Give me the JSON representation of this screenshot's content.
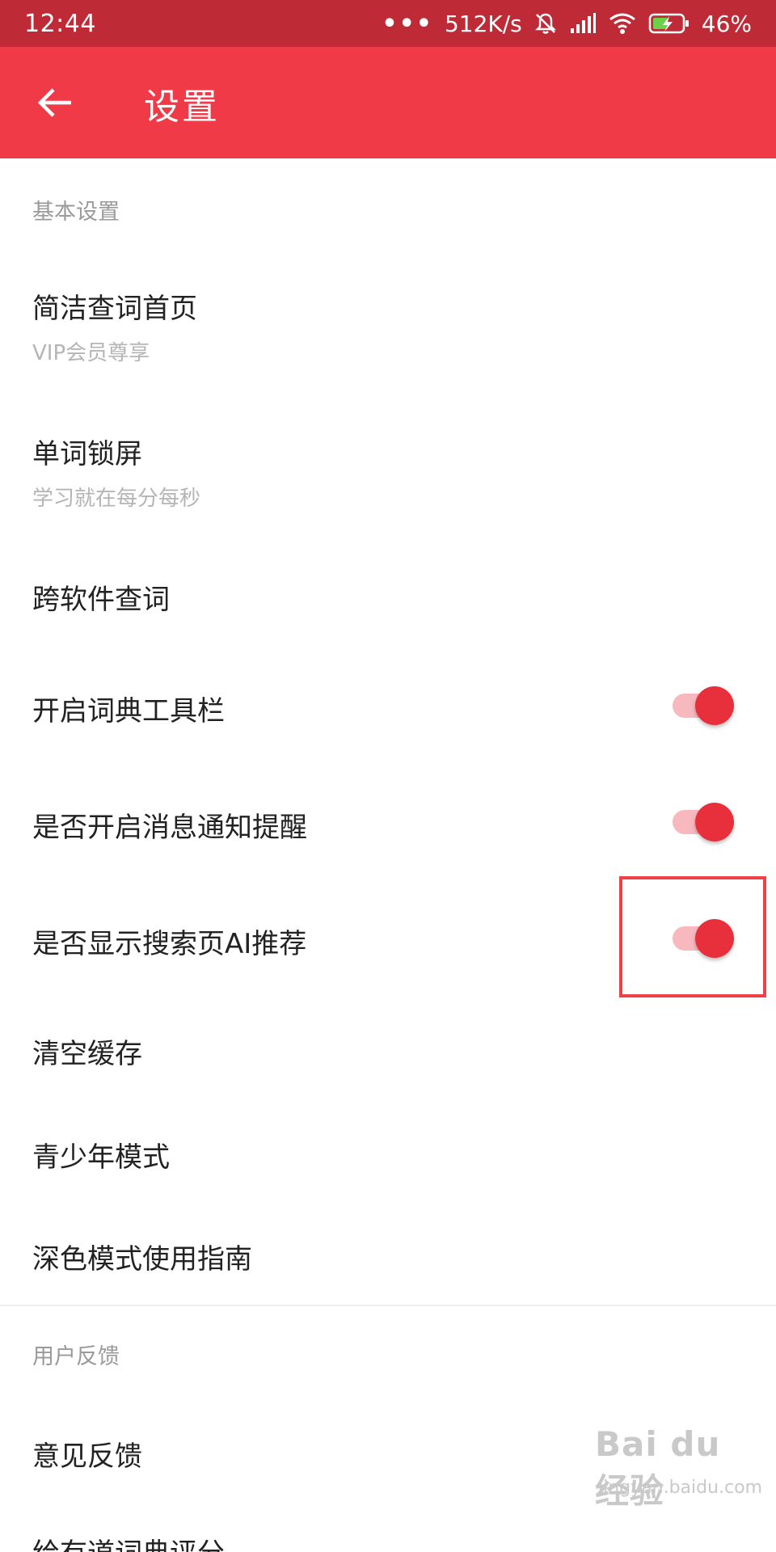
{
  "status_bar": {
    "time": "12:44",
    "more": "•••",
    "net_speed": "512K/s",
    "battery": "46%",
    "icons": [
      "mute-icon",
      "signal-icon",
      "wifi-icon",
      "battery-charging-icon"
    ]
  },
  "toolbar": {
    "title": "设置",
    "back_icon": "back-arrow-icon"
  },
  "sections": {
    "basic": "基本设置",
    "feedback": "用户反馈"
  },
  "items": [
    {
      "label": "简洁查词首页",
      "sub": "VIP会员尊享"
    },
    {
      "label": "单词锁屏",
      "sub": "学习就在每分每秒"
    },
    {
      "label": "跨软件查词"
    },
    {
      "label": "开启词典工具栏",
      "toggle": true
    },
    {
      "label": "是否开启消息通知提醒",
      "toggle": true
    },
    {
      "label": "是否显示搜索页AI推荐",
      "toggle": true
    },
    {
      "label": "清空缓存"
    },
    {
      "label": "青少年模式"
    },
    {
      "label": "深色模式使用指南"
    },
    {
      "label": "意见反馈"
    },
    {
      "label": "给有道词典评分"
    }
  ],
  "watermark": {
    "logo": "Bai du 经验",
    "url": "jingyan.baidu.com"
  },
  "colors": {
    "toolbar": "#f03a48",
    "status_bar": "#be2a36",
    "toggle_on": "#e8303d",
    "highlight_box": "#f04048"
  }
}
